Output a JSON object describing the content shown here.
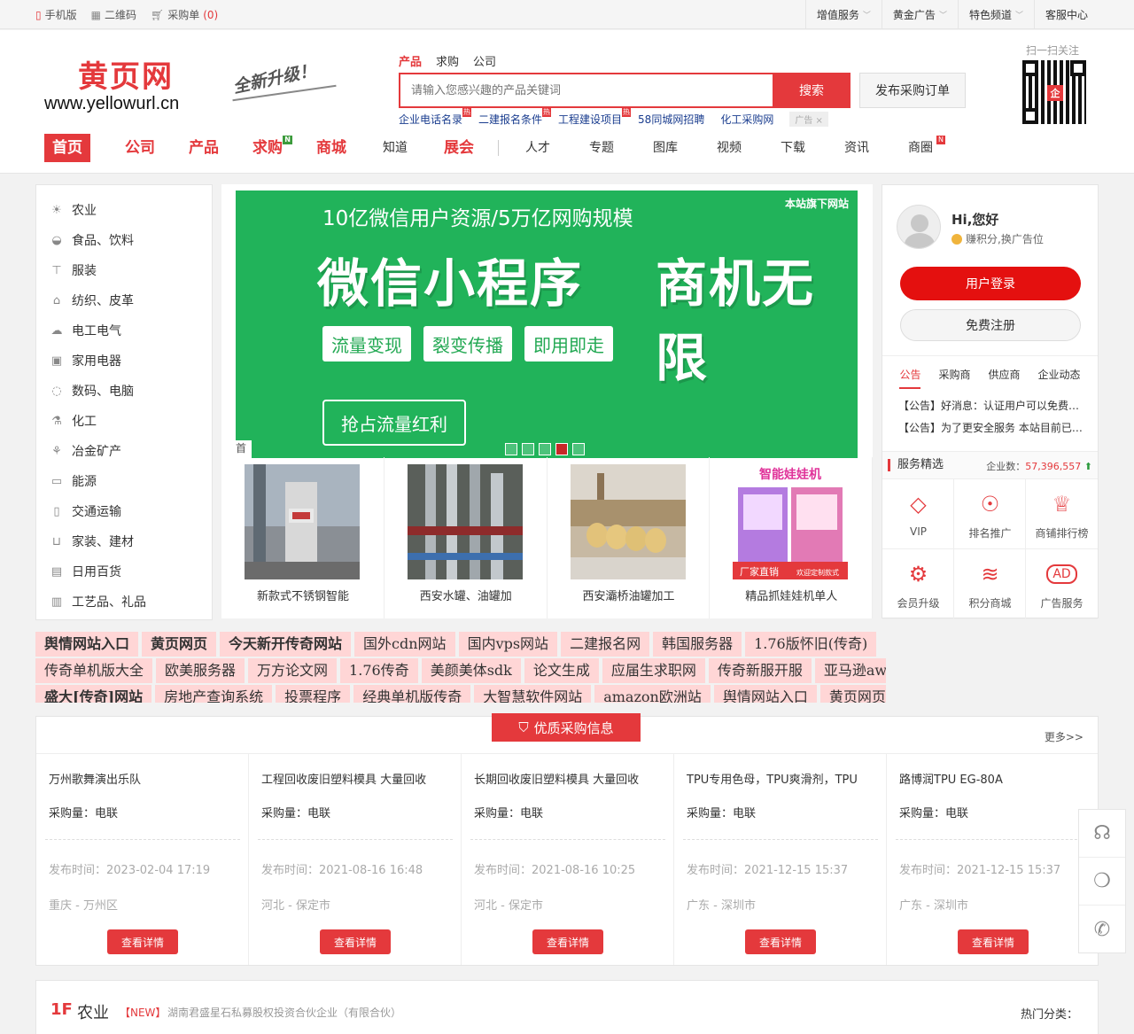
{
  "topbar": {
    "mobile": "手机版",
    "qrcode": "二维码",
    "cart": "采购单",
    "cart_count": "(0)",
    "right": [
      "增值服务",
      "黄金广告",
      "特色频道",
      "客服中心"
    ]
  },
  "logo": {
    "cn": "黄页网",
    "en": "www.yellowurl.cn",
    "slogan": "全新升级！"
  },
  "search": {
    "tabs": [
      "产品",
      "求购",
      "公司"
    ],
    "placeholder": "请输入您感兴趣的产品关键词",
    "button": "搜索",
    "publish": "发布采购订单",
    "hot": [
      "企业电话名录",
      "二建报名条件",
      "工程建设项目",
      "58同城网招聘",
      "化工采购网"
    ],
    "hot_badge": "热",
    "ad": "广告"
  },
  "qr_label": "扫一扫关注",
  "qr_center": "企",
  "nav": {
    "main": [
      "首页",
      "公司",
      "产品",
      "求购",
      "商城",
      "知道",
      "展会"
    ],
    "sub": [
      "人才",
      "专题",
      "图库",
      "视频",
      "下载",
      "资讯",
      "商圈"
    ],
    "new_badge": "N"
  },
  "categories": [
    "农业",
    "食品、饮料",
    "服装",
    "纺织、皮革",
    "电工电气",
    "家用电器",
    "数码、电脑",
    "化工",
    "冶金矿产",
    "能源",
    "交通运输",
    "家装、建材",
    "日用百货",
    "工艺品、礼品"
  ],
  "banner": {
    "line1": "10亿微信用户资源/5万亿网购规模",
    "big1": "微信小程序",
    "big2": "商机无限",
    "tags": [
      "流量变现",
      "裂变传播",
      "即用即走"
    ],
    "cta": "抢占流量红利",
    "corner": "本站旗下网站",
    "edge": "首",
    "active_slide": 4,
    "slide_count": 5
  },
  "products": [
    {
      "caption": "新款式不锈钢智能"
    },
    {
      "caption": "西安水罐、油罐加"
    },
    {
      "caption": "西安灞桥油罐加工"
    },
    {
      "caption": "精品抓娃娃机单人",
      "banner_text": "智能娃娃机",
      "footer_text": "厂家直销",
      "footer_sub": "欢迎定制款式"
    }
  ],
  "user": {
    "greeting": "Hi,您好",
    "points": "赚积分,换广告位",
    "login": "用户登录",
    "register": "免费注册",
    "tabs": [
      "公告",
      "采购商",
      "供应商",
      "企业动态"
    ],
    "notices": [
      "【公告】好消息：认证用户可以免费发布",
      "【公告】为了更安全服务 本站目前已开启"
    ],
    "service_title": "服务精选",
    "company_label": "企业数：",
    "company_count": "57,396,557",
    "services": [
      "VIP",
      "排名推广",
      "商铺排行榜",
      "会员升级",
      "积分商城",
      "广告服务"
    ]
  },
  "links": [
    [
      "舆情网站入口",
      "黄页网页",
      "今天新开传奇网站",
      "国外cdn网站",
      "国内vps网站",
      "二建报名网",
      "韩国服务器",
      "1.76版怀旧(传奇)"
    ],
    [
      "传奇单机版大全",
      "欧美服务器",
      "万方论文网",
      "1.76传奇",
      "美颜美体sdk",
      "论文生成",
      "应届生求职网",
      "传奇新服开服",
      "亚马逊aws"
    ],
    [
      "盛大[传奇]网站",
      "房地产查询系统",
      "投票程序",
      "经典单机版传奇",
      "大智慧软件网站",
      "amazon欧洲站",
      "舆情网站入口",
      "黄页网页"
    ]
  ],
  "procurement": {
    "title": "优质采购信息",
    "more": "更多>>",
    "qty_label": "采购量：",
    "date_label": "发布时间：",
    "detail": "查看详情",
    "items": [
      {
        "title": "万州歌舞演出乐队",
        "qty": "电联",
        "date": "2023-02-04 17:19",
        "loc": "重庆 - 万州区"
      },
      {
        "title": "工程回收废旧塑料模具 大量回收",
        "qty": "电联",
        "date": "2021-08-16 16:48",
        "loc": "河北 - 保定市"
      },
      {
        "title": "长期回收废旧塑料模具 大量回收",
        "qty": "电联",
        "date": "2021-08-16 10:25",
        "loc": "河北 - 保定市"
      },
      {
        "title": "TPU专用色母，TPU爽滑剂，TPU",
        "qty": "电联",
        "date": "2021-12-15 15:37",
        "loc": "广东 - 深圳市"
      },
      {
        "title": "路博润TPU EG-80A",
        "qty": "电联",
        "date": "2021-12-15 15:37",
        "loc": "广东 - 深圳市"
      }
    ]
  },
  "floor": {
    "num": "1F",
    "name": "农业",
    "new": "【NEW】",
    "company": "湖南君盛星石私募股权投资合伙企业（有限合伙）",
    "hot": "热门分类："
  },
  "colors": {
    "brand": "#e4393c",
    "banner_green": "#21b35a",
    "link_band": "#ffd6d6"
  }
}
